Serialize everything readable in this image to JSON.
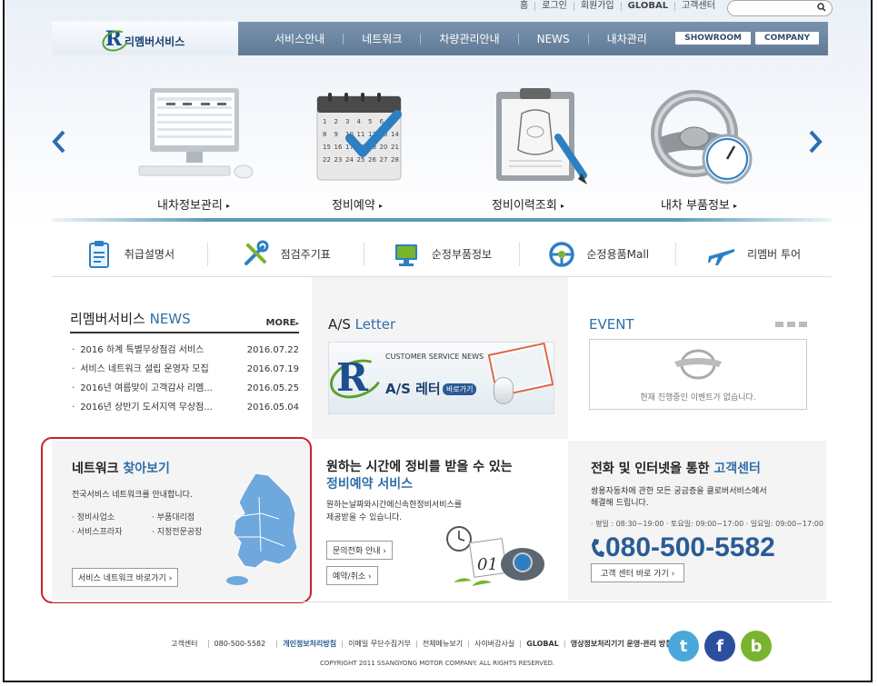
{
  "colors": {
    "accent": "#2f6ea8",
    "nav": "#6b86a1",
    "highlight": "#c8222a",
    "brand_green": "#5aa02c"
  },
  "util_nav": {
    "home": "홈",
    "login": "로그인",
    "join": "회원가입",
    "global": "GLOBAL",
    "support": "고객센터"
  },
  "logo": {
    "mark": "R",
    "name": "리멤버서비스"
  },
  "nav": {
    "items": [
      "서비스안내",
      "네트워크",
      "차량관리안내",
      "NEWS",
      "내차관리"
    ],
    "showroom": "SHOWROOM",
    "company": "COMPANY"
  },
  "hero": {
    "items": [
      {
        "label": "내차정보관리",
        "icon": "computer-icon"
      },
      {
        "label": "정비예약",
        "icon": "calendar-check-icon"
      },
      {
        "label": "정비이력조회",
        "icon": "clipboard-car-icon"
      },
      {
        "label": "내차 부품정보",
        "icon": "steering-wheel-icon"
      }
    ],
    "arrow_glyph": "▸",
    "calendar_days": [
      "1",
      "2",
      "3",
      "4",
      "5",
      "6",
      "7",
      "8",
      "9",
      "10",
      "11",
      "12",
      "13",
      "14",
      "15",
      "16",
      "17",
      "18",
      "19",
      "20",
      "21",
      "22",
      "23",
      "24",
      "25",
      "26",
      "27",
      "28"
    ]
  },
  "quick": {
    "items": [
      {
        "label": "취급설명서",
        "icon": "manual-icon"
      },
      {
        "label": "점검주기표",
        "icon": "tools-icon"
      },
      {
        "label": "순정부품정보",
        "icon": "monitor-icon"
      },
      {
        "label": "순정용품Mall",
        "icon": "wheel-icon"
      },
      {
        "label": "리멤버 투어",
        "icon": "airplane-icon"
      }
    ]
  },
  "news": {
    "title": "리멤버서비스",
    "title_accent": "NEWS",
    "more": "MORE",
    "more_glyph": "▸",
    "items": [
      {
        "title": "2016 하계 특별무상점검 서비스",
        "date": "2016.07.22"
      },
      {
        "title": "서비스 네트워크 설립 운영자 모집",
        "date": "2016.07.19"
      },
      {
        "title": "2016년 여름맞이 고객감사 리멤...",
        "date": "2016.05.25"
      },
      {
        "title": "2016년 상반기 도서지역 무상점...",
        "date": "2016.05.04"
      }
    ]
  },
  "as_letter": {
    "title": "A/S",
    "title_accent": "Letter",
    "banner_eyebrow": "CUSTOMER SERVICE NEWS",
    "banner_mark": "R",
    "banner_name": "A/S 레터",
    "banner_go": "바로가기"
  },
  "event": {
    "title": "EVENT",
    "empty": "현재 진행중인 이벤트가 없습니다."
  },
  "network": {
    "title": "네트워크",
    "title_accent": "찾아보기",
    "sub": "전국서비스 네트워크를 안내합니다.",
    "items": [
      "정비사업소",
      "부품대리점",
      "서비스프라자",
      "지정전문공장"
    ],
    "button": "서비스 네트워크 바로가기",
    "button_glyph": "›"
  },
  "reservation": {
    "title_line1": "원하는 시간에 정비를 받을 수 있는",
    "title_accent": "정비예약 서비스",
    "sub_line1": "원하는날짜와시간에신속한정비서비스를",
    "sub_line2": "제공받을 수 있습니다.",
    "phone_button": "문의전화 안내",
    "cancel_button": "예약/취소",
    "button_glyph": "›",
    "art_day": "01"
  },
  "customer_center": {
    "title": "전화 및 인터넷을 통한",
    "title_accent": "고객센터",
    "sub_line1": "쌍용자동차에 관한 모든 궁금증을 클로버서비스에서",
    "sub_line2": "해결해 드립니다.",
    "hours": "· 평일 : 08:30~19:00 · 토요일: 09:00~17:00 · 일요일: 09:00~17:00",
    "phone": "080-500-5582",
    "button": "고객 센터 바로 가기",
    "button_glyph": "›"
  },
  "footer": {
    "support": "고객센터",
    "support_phone": "080-500-5582",
    "privacy": "개인정보처리방침",
    "no_email": "이메일 무단수집거부",
    "sitemap": "전체메뉴보기",
    "cyber": "사이버감사실",
    "global": "GLOBAL",
    "cctv": "영상정보처리기기 운영·관리 방침",
    "copyright": "COPYRIGHT 2011 SSANGYONG MOTOR COMPANY. ALL RIGHTS RESERVED.",
    "social": [
      {
        "name": "twitter-icon",
        "glyph": "t",
        "color": "#4aa8d8"
      },
      {
        "name": "facebook-icon",
        "glyph": "f",
        "color": "#2b4f9e"
      },
      {
        "name": "blog-icon",
        "glyph": "b",
        "color": "#7ab32e"
      }
    ]
  }
}
